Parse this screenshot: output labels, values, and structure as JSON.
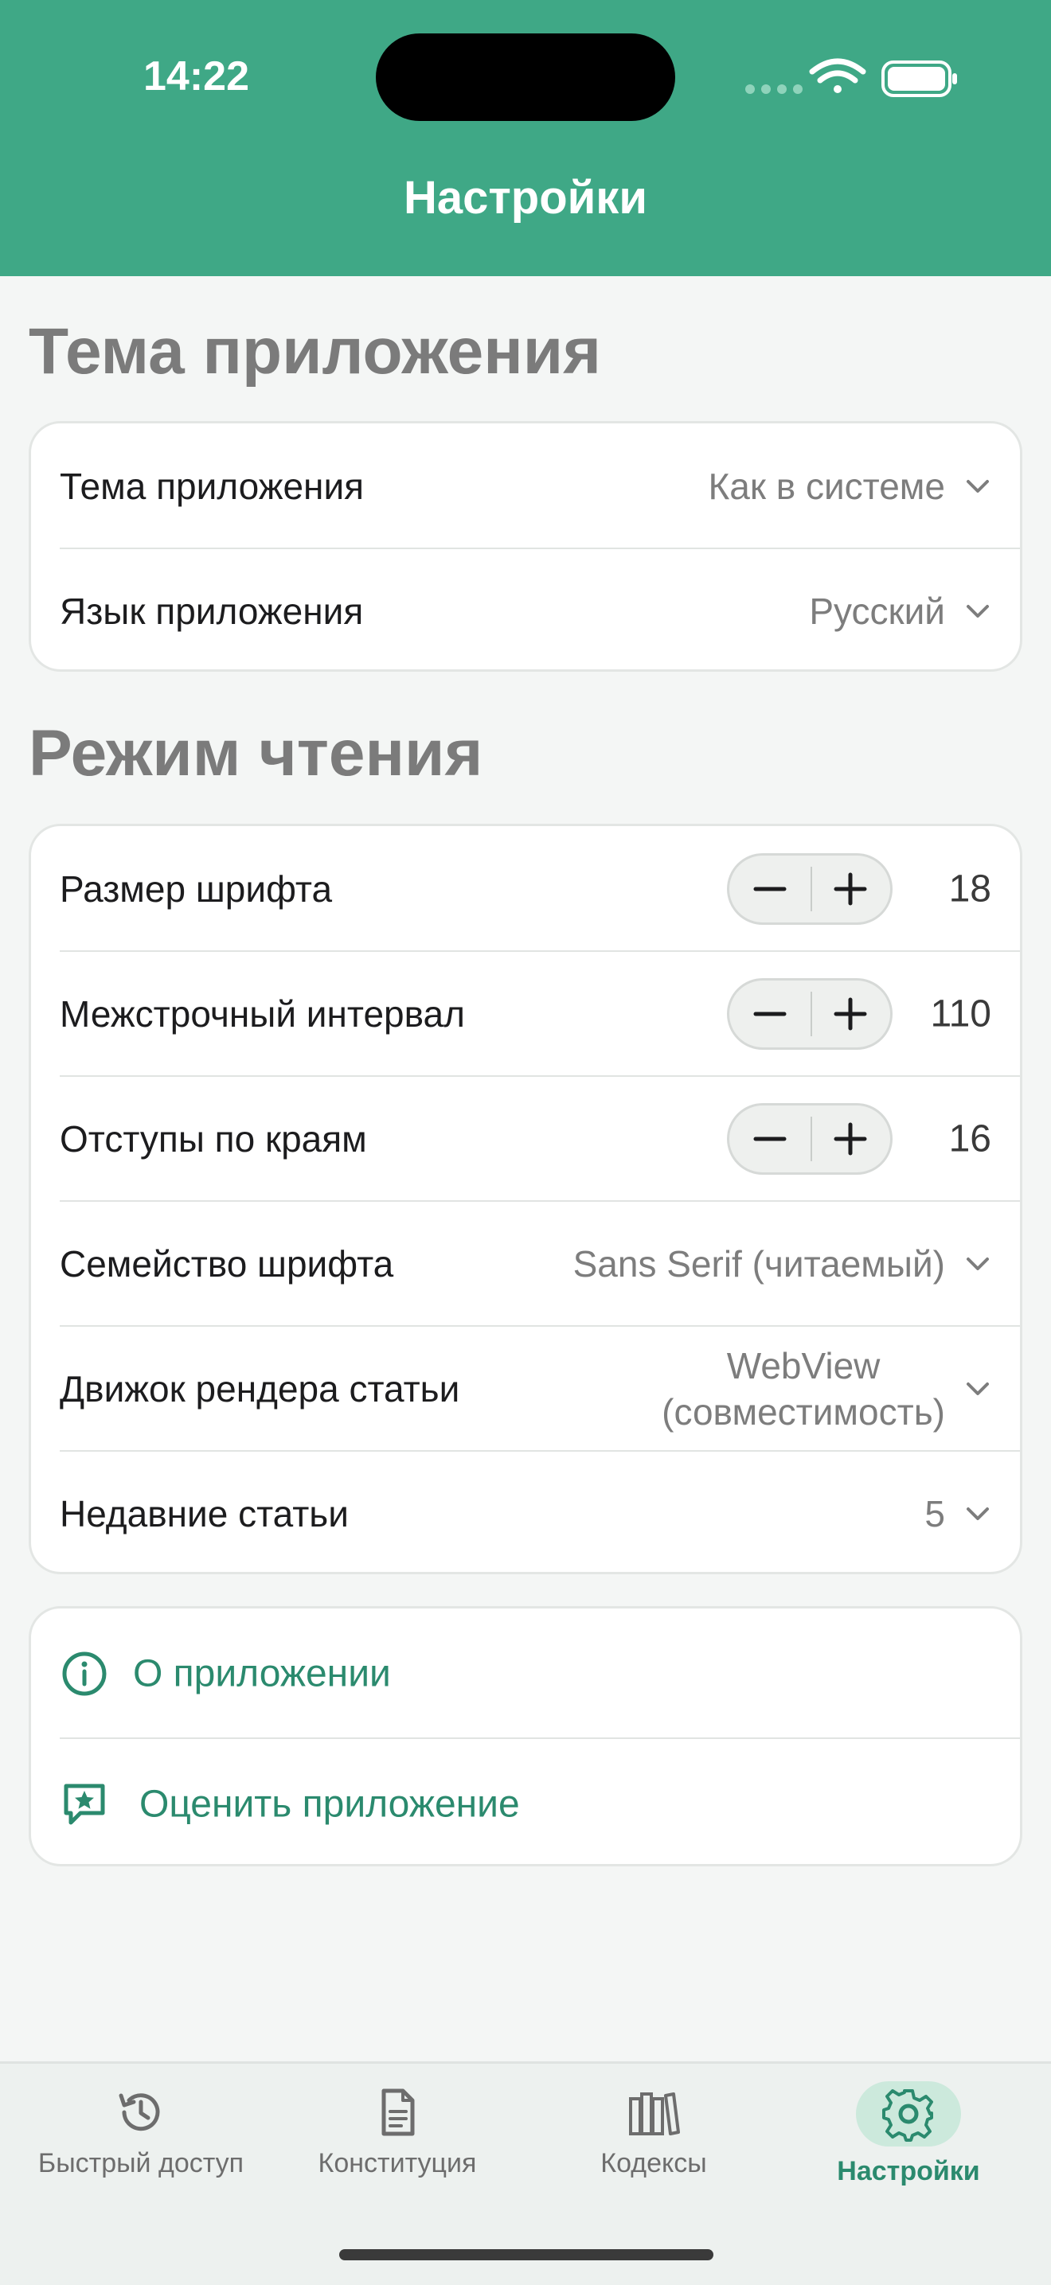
{
  "status_bar": {
    "time": "14:22"
  },
  "header": {
    "title": "Настройки"
  },
  "sections": {
    "theme": {
      "title": "Тема приложения",
      "rows": [
        {
          "label": "Тема приложения",
          "value": "Как в системе"
        },
        {
          "label": "Язык приложения",
          "value": "Русский"
        }
      ]
    },
    "reading": {
      "title": "Режим чтения",
      "steppers": [
        {
          "label": "Размер шрифта",
          "value": "18"
        },
        {
          "label": "Межстрочный интервал",
          "value": "110"
        },
        {
          "label": "Отступы по краям",
          "value": "16"
        }
      ],
      "pickers": [
        {
          "label": "Семейство шрифта",
          "value": "Sans Serif (читаемый)"
        },
        {
          "label": "Движок рендера статьи",
          "value_line1": "WebView",
          "value_line2": "(совместимость)"
        },
        {
          "label": "Недавние статьи",
          "value": "5"
        }
      ]
    },
    "about": {
      "items": [
        {
          "label": "О приложении",
          "icon": "info-icon"
        },
        {
          "label": "Оценить приложение",
          "icon": "rate-star-icon"
        }
      ]
    }
  },
  "tabbar": {
    "tabs": [
      {
        "label": "Быстрый доступ",
        "icon": "history-icon",
        "active": false
      },
      {
        "label": "Конституция",
        "icon": "document-icon",
        "active": false
      },
      {
        "label": "Кодексы",
        "icon": "books-icon",
        "active": false
      },
      {
        "label": "Настройки",
        "icon": "gear-icon",
        "active": true
      }
    ]
  },
  "colors": {
    "accent": "#3fa886",
    "link": "#2b8a6e",
    "active_pill": "#cce9dc",
    "background": "#f4f6f5"
  }
}
